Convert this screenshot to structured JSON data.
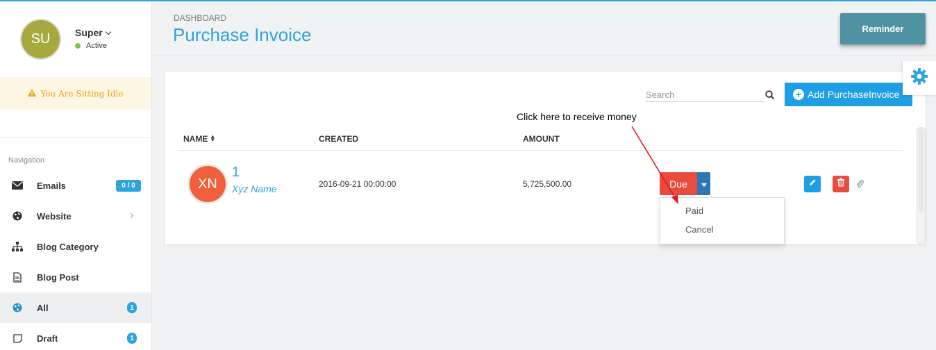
{
  "sidebar": {
    "avatar_initials": "SU",
    "user_name": "Super",
    "user_status": "Active",
    "idle_message": "You Are Sitting Idle",
    "nav_title": "Navigation",
    "items": [
      {
        "label": "Emails",
        "icon": "envelope-icon",
        "badge": "0 / 0"
      },
      {
        "label": "Website",
        "icon": "globe-icon",
        "chevron": true
      },
      {
        "label": "Blog Category",
        "icon": "sitemap-icon"
      },
      {
        "label": "Blog Post",
        "icon": "document-icon"
      },
      {
        "label": "All",
        "icon": "globe-icon",
        "badge": "1",
        "active": true
      },
      {
        "label": "Draft",
        "icon": "square-icon",
        "badge": "1"
      }
    ]
  },
  "header": {
    "breadcrumb": "DASHBOARD",
    "title": "Purchase Invoice",
    "reminder_label": "Reminder"
  },
  "toolbar": {
    "search_placeholder": "Search",
    "add_label": "Add PurchaseInvoice"
  },
  "table": {
    "columns": [
      "NAME",
      "CREATED",
      "AMOUNT"
    ],
    "rows": [
      {
        "avatar": "XN",
        "id": "1",
        "name": "Xyz Name",
        "created": "2016-09-21 00:00:00",
        "amount": "5,725,500.00",
        "status": "Due",
        "status_options": [
          "Paid",
          "Cancel"
        ]
      }
    ]
  },
  "annotation": {
    "text": "Click here to receive money"
  },
  "colors": {
    "accent": "#2ea3df",
    "due": "#e94b3d",
    "avatar_user": "#a5a93e",
    "avatar_row": "#f0603c",
    "reminder": "#4f92a2"
  }
}
